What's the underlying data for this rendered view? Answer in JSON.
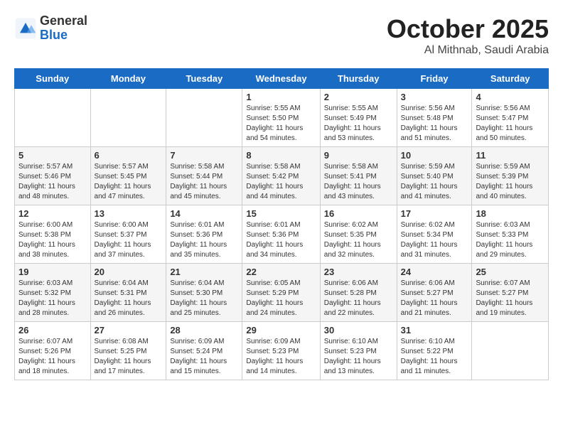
{
  "header": {
    "logo_general": "General",
    "logo_blue": "Blue",
    "month_title": "October 2025",
    "location": "Al Mithnab, Saudi Arabia"
  },
  "weekdays": [
    "Sunday",
    "Monday",
    "Tuesday",
    "Wednesday",
    "Thursday",
    "Friday",
    "Saturday"
  ],
  "weeks": [
    [
      {
        "day": "",
        "info": ""
      },
      {
        "day": "",
        "info": ""
      },
      {
        "day": "",
        "info": ""
      },
      {
        "day": "1",
        "info": "Sunrise: 5:55 AM\nSunset: 5:50 PM\nDaylight: 11 hours\nand 54 minutes."
      },
      {
        "day": "2",
        "info": "Sunrise: 5:55 AM\nSunset: 5:49 PM\nDaylight: 11 hours\nand 53 minutes."
      },
      {
        "day": "3",
        "info": "Sunrise: 5:56 AM\nSunset: 5:48 PM\nDaylight: 11 hours\nand 51 minutes."
      },
      {
        "day": "4",
        "info": "Sunrise: 5:56 AM\nSunset: 5:47 PM\nDaylight: 11 hours\nand 50 minutes."
      }
    ],
    [
      {
        "day": "5",
        "info": "Sunrise: 5:57 AM\nSunset: 5:46 PM\nDaylight: 11 hours\nand 48 minutes."
      },
      {
        "day": "6",
        "info": "Sunrise: 5:57 AM\nSunset: 5:45 PM\nDaylight: 11 hours\nand 47 minutes."
      },
      {
        "day": "7",
        "info": "Sunrise: 5:58 AM\nSunset: 5:44 PM\nDaylight: 11 hours\nand 45 minutes."
      },
      {
        "day": "8",
        "info": "Sunrise: 5:58 AM\nSunset: 5:42 PM\nDaylight: 11 hours\nand 44 minutes."
      },
      {
        "day": "9",
        "info": "Sunrise: 5:58 AM\nSunset: 5:41 PM\nDaylight: 11 hours\nand 43 minutes."
      },
      {
        "day": "10",
        "info": "Sunrise: 5:59 AM\nSunset: 5:40 PM\nDaylight: 11 hours\nand 41 minutes."
      },
      {
        "day": "11",
        "info": "Sunrise: 5:59 AM\nSunset: 5:39 PM\nDaylight: 11 hours\nand 40 minutes."
      }
    ],
    [
      {
        "day": "12",
        "info": "Sunrise: 6:00 AM\nSunset: 5:38 PM\nDaylight: 11 hours\nand 38 minutes."
      },
      {
        "day": "13",
        "info": "Sunrise: 6:00 AM\nSunset: 5:37 PM\nDaylight: 11 hours\nand 37 minutes."
      },
      {
        "day": "14",
        "info": "Sunrise: 6:01 AM\nSunset: 5:36 PM\nDaylight: 11 hours\nand 35 minutes."
      },
      {
        "day": "15",
        "info": "Sunrise: 6:01 AM\nSunset: 5:36 PM\nDaylight: 11 hours\nand 34 minutes."
      },
      {
        "day": "16",
        "info": "Sunrise: 6:02 AM\nSunset: 5:35 PM\nDaylight: 11 hours\nand 32 minutes."
      },
      {
        "day": "17",
        "info": "Sunrise: 6:02 AM\nSunset: 5:34 PM\nDaylight: 11 hours\nand 31 minutes."
      },
      {
        "day": "18",
        "info": "Sunrise: 6:03 AM\nSunset: 5:33 PM\nDaylight: 11 hours\nand 29 minutes."
      }
    ],
    [
      {
        "day": "19",
        "info": "Sunrise: 6:03 AM\nSunset: 5:32 PM\nDaylight: 11 hours\nand 28 minutes."
      },
      {
        "day": "20",
        "info": "Sunrise: 6:04 AM\nSunset: 5:31 PM\nDaylight: 11 hours\nand 26 minutes."
      },
      {
        "day": "21",
        "info": "Sunrise: 6:04 AM\nSunset: 5:30 PM\nDaylight: 11 hours\nand 25 minutes."
      },
      {
        "day": "22",
        "info": "Sunrise: 6:05 AM\nSunset: 5:29 PM\nDaylight: 11 hours\nand 24 minutes."
      },
      {
        "day": "23",
        "info": "Sunrise: 6:06 AM\nSunset: 5:28 PM\nDaylight: 11 hours\nand 22 minutes."
      },
      {
        "day": "24",
        "info": "Sunrise: 6:06 AM\nSunset: 5:27 PM\nDaylight: 11 hours\nand 21 minutes."
      },
      {
        "day": "25",
        "info": "Sunrise: 6:07 AM\nSunset: 5:27 PM\nDaylight: 11 hours\nand 19 minutes."
      }
    ],
    [
      {
        "day": "26",
        "info": "Sunrise: 6:07 AM\nSunset: 5:26 PM\nDaylight: 11 hours\nand 18 minutes."
      },
      {
        "day": "27",
        "info": "Sunrise: 6:08 AM\nSunset: 5:25 PM\nDaylight: 11 hours\nand 17 minutes."
      },
      {
        "day": "28",
        "info": "Sunrise: 6:09 AM\nSunset: 5:24 PM\nDaylight: 11 hours\nand 15 minutes."
      },
      {
        "day": "29",
        "info": "Sunrise: 6:09 AM\nSunset: 5:23 PM\nDaylight: 11 hours\nand 14 minutes."
      },
      {
        "day": "30",
        "info": "Sunrise: 6:10 AM\nSunset: 5:23 PM\nDaylight: 11 hours\nand 13 minutes."
      },
      {
        "day": "31",
        "info": "Sunrise: 6:10 AM\nSunset: 5:22 PM\nDaylight: 11 hours\nand 11 minutes."
      },
      {
        "day": "",
        "info": ""
      }
    ]
  ]
}
